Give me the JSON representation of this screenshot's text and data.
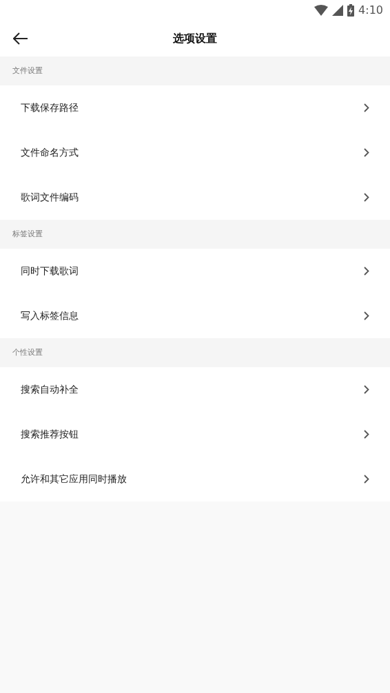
{
  "status_bar": {
    "time": "4:10"
  },
  "header": {
    "title": "选项设置"
  },
  "sections": [
    {
      "title": "文件设置",
      "items": [
        {
          "label": "下载保存路径"
        },
        {
          "label": "文件命名方式"
        },
        {
          "label": "歌词文件编码"
        }
      ]
    },
    {
      "title": "标签设置",
      "items": [
        {
          "label": "同时下载歌词"
        },
        {
          "label": "写入标签信息"
        }
      ]
    },
    {
      "title": "个性设置",
      "items": [
        {
          "label": "搜索自动补全"
        },
        {
          "label": "搜索推荐按钮"
        },
        {
          "label": "允许和其它应用同时播放"
        }
      ]
    }
  ]
}
